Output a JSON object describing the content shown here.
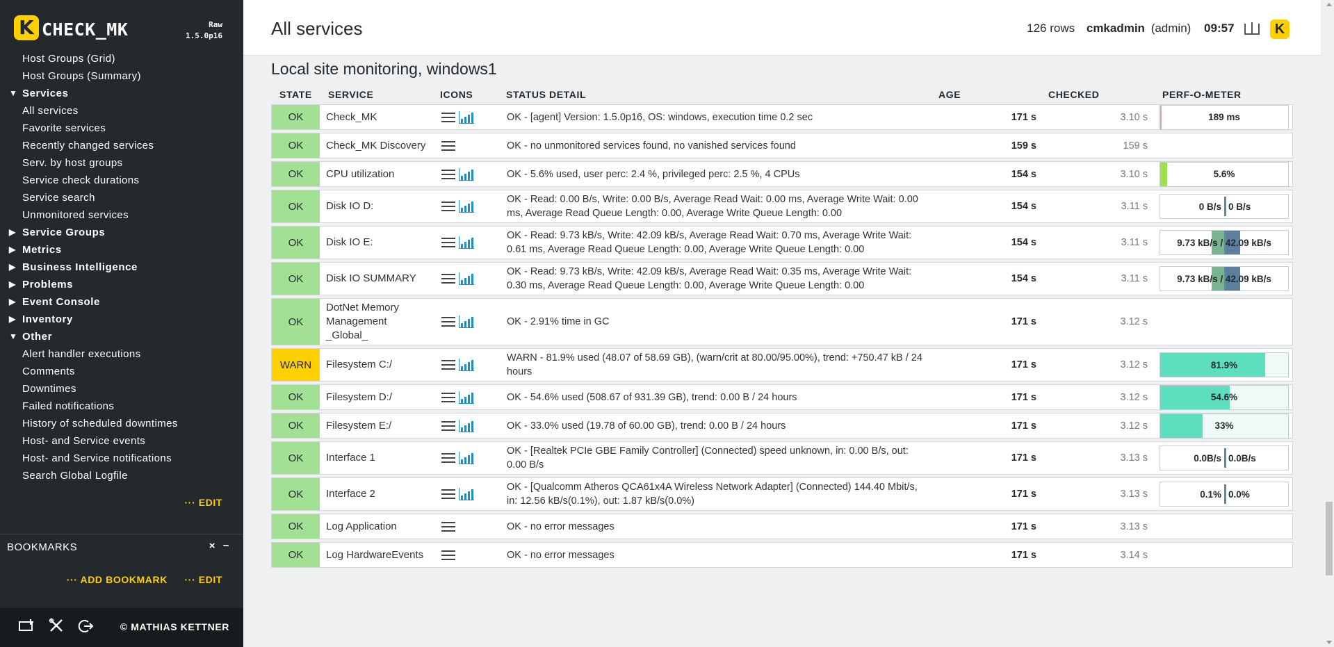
{
  "brand": {
    "logo_letter": "K",
    "name": "CHECK_MK",
    "edition": "Raw",
    "version": "1.5.0p16"
  },
  "sidebar": {
    "items": [
      {
        "type": "item",
        "label": "Host Groups (Grid)"
      },
      {
        "type": "item",
        "label": "Host Groups (Summary)"
      },
      {
        "type": "section",
        "label": "Services",
        "expanded": true
      },
      {
        "type": "item",
        "label": "All services"
      },
      {
        "type": "item",
        "label": "Favorite services"
      },
      {
        "type": "item",
        "label": "Recently changed services"
      },
      {
        "type": "item",
        "label": "Serv. by host groups"
      },
      {
        "type": "item",
        "label": "Service check durations"
      },
      {
        "type": "item",
        "label": "Service search"
      },
      {
        "type": "item",
        "label": "Unmonitored services"
      },
      {
        "type": "section",
        "label": "Service Groups",
        "expanded": false
      },
      {
        "type": "section",
        "label": "Metrics",
        "expanded": false
      },
      {
        "type": "section",
        "label": "Business Intelligence",
        "expanded": false
      },
      {
        "type": "section",
        "label": "Problems",
        "expanded": false
      },
      {
        "type": "section",
        "label": "Event Console",
        "expanded": false
      },
      {
        "type": "section",
        "label": "Inventory",
        "expanded": false
      },
      {
        "type": "section",
        "label": "Other",
        "expanded": true
      },
      {
        "type": "item",
        "label": "Alert handler executions"
      },
      {
        "type": "item",
        "label": "Comments"
      },
      {
        "type": "item",
        "label": "Downtimes"
      },
      {
        "type": "item",
        "label": "Failed notifications"
      },
      {
        "type": "item",
        "label": "History of scheduled downtimes"
      },
      {
        "type": "item",
        "label": "Host- and Service events"
      },
      {
        "type": "item",
        "label": "Host- and Service notifications"
      },
      {
        "type": "item",
        "label": "Search Global Logfile"
      }
    ],
    "views_edit": "··· EDIT",
    "bookmarks_title": "BOOKMARKS",
    "bookmarks_close": "×",
    "bookmarks_minimize": "−",
    "add_bookmark": "··· ADD BOOKMARK",
    "bookmarks_edit": "··· EDIT",
    "copyright": "© MATHIAS KETTNER"
  },
  "header": {
    "title": "All services",
    "rows": "126 rows",
    "user": "cmkadmin",
    "role": "(admin)",
    "time": "09:57"
  },
  "group_title": "Local site monitoring, windows1",
  "columns": [
    "STATE",
    "SERVICE",
    "ICONS",
    "STATUS DETAIL",
    "AGE",
    "CHECKED",
    "PERF-O-METER"
  ],
  "colors": {
    "ok": "#a2e093",
    "warn": "#ffd000",
    "brand": "#ffd000",
    "sidebar": "#23292d"
  },
  "services": [
    {
      "state": "OK",
      "service": "Check_MK",
      "graph": true,
      "detail": "OK - [agent] Version: 1.5.0p16, OS: windows, execution time 0.2 sec",
      "age": "171 s",
      "checked": "3.10 s",
      "h": 37,
      "perf": {
        "kind": "bar",
        "label": "189 ms",
        "fill": 0.01,
        "color": "#d4a5b8"
      }
    },
    {
      "state": "OK",
      "service": "Check_MK Discovery",
      "graph": false,
      "detail": "OK - no unmonitored services found, no vanished services found",
      "age": "159 s",
      "checked": "159 s",
      "h": 37,
      "perf": null
    },
    {
      "state": "OK",
      "service": "CPU utilization",
      "graph": true,
      "detail": "OK - 5.6% used, user perc: 2.4 %, privileged perc: 2.5 %, 4 CPUs",
      "age": "154 s",
      "checked": "3.10 s",
      "h": 37,
      "perf": {
        "kind": "bar",
        "label": "5.6%",
        "fill": 0.056,
        "color": "#a0e050"
      }
    },
    {
      "state": "OK",
      "service": "Disk IO D:",
      "graph": true,
      "detail": "OK - Read: 0.00 B/s, Write: 0.00 B/s, Average Read Wait: 0.00 ms, Average Write Wait: 0.00 ms, Average Read Queue Length: 0.00, Average Write Queue Length: 0.00",
      "age": "154 s",
      "checked": "3.11 s",
      "h": 48,
      "perf": {
        "kind": "split",
        "left": "0 B/s",
        "right": "0 B/s",
        "lfill": 0,
        "rfill": 0
      }
    },
    {
      "state": "OK",
      "service": "Disk IO E:",
      "graph": true,
      "detail": "OK - Read: 9.73 kB/s, Write: 42.09 kB/s, Average Read Wait: 0.70 ms, Average Write Wait: 0.61 ms, Average Read Queue Length: 0.00, Average Write Queue Length: 0.00",
      "age": "154 s",
      "checked": "3.11 s",
      "h": 48,
      "perf": {
        "kind": "split",
        "label": "9.73 kB/s / 42.09 kB/s",
        "lfill": 0.2,
        "rfill": 0.25
      }
    },
    {
      "state": "OK",
      "service": "Disk IO SUMMARY",
      "graph": true,
      "detail": "OK - Read: 9.73 kB/s, Write: 42.09 kB/s, Average Read Wait: 0.35 ms, Average Write Wait: 0.30 ms, Average Read Queue Length: 0.00, Average Write Queue Length: 0.00",
      "age": "154 s",
      "checked": "3.11 s",
      "h": 48,
      "perf": {
        "kind": "split",
        "label": "9.73 kB/s / 42.09 kB/s",
        "lfill": 0.2,
        "rfill": 0.25
      }
    },
    {
      "state": "OK",
      "service": "DotNet Memory Management _Global_",
      "graph": true,
      "detail": "OK - 2.91% time in GC",
      "age": "171 s",
      "checked": "3.12 s",
      "h": 68,
      "perf": null
    },
    {
      "state": "WARN",
      "service": "Filesystem C:/",
      "graph": true,
      "detail": "WARN - 81.9% used (48.07 of 58.69 GB), (warn/crit at 80.00/95.00%), trend: +750.47 kB / 24 hours",
      "age": "171 s",
      "checked": "3.12 s",
      "h": 48,
      "perf": {
        "kind": "bar",
        "label": "81.9%",
        "fill": 0.819,
        "color": "#5ddfbf"
      }
    },
    {
      "state": "OK",
      "service": "Filesystem D:/",
      "graph": true,
      "detail": "OK - 54.6% used (508.67 of 931.39 GB), trend: 0.00 B / 24 hours",
      "age": "171 s",
      "checked": "3.12 s",
      "h": 37,
      "perf": {
        "kind": "bar",
        "label": "54.6%",
        "fill": 0.546,
        "color": "#5ddfbf"
      }
    },
    {
      "state": "OK",
      "service": "Filesystem E:/",
      "graph": true,
      "detail": "OK - 33.0% used (19.78 of 60.00 GB), trend: 0.00 B / 24 hours",
      "age": "171 s",
      "checked": "3.12 s",
      "h": 37,
      "perf": {
        "kind": "bar",
        "label": "33%",
        "fill": 0.33,
        "color": "#5ddfbf"
      }
    },
    {
      "state": "OK",
      "service": "Interface 1",
      "graph": true,
      "detail": "OK - [Realtek PCIe GBE Family Controller] (Connected) speed unknown, in: 0.00 B/s, out: 0.00 B/s",
      "age": "171 s",
      "checked": "3.13 s",
      "h": 48,
      "perf": {
        "kind": "split",
        "left": "0.0B/s",
        "right": "0.0B/s",
        "lfill": 0,
        "rfill": 0
      }
    },
    {
      "state": "OK",
      "service": "Interface 2",
      "graph": true,
      "detail": "OK - [Qualcomm Atheros QCA61x4A Wireless Network Adapter] (Connected) 144.40 Mbit/s, in: 12.56 kB/s(0.1%), out: 1.87 kB/s(0.0%)",
      "age": "171 s",
      "checked": "3.13 s",
      "h": 48,
      "perf": {
        "kind": "split",
        "left": "0.1%",
        "right": "0.0%",
        "lfill": 0,
        "rfill": 0
      }
    },
    {
      "state": "OK",
      "service": "Log Application",
      "graph": false,
      "detail": "OK - no error messages",
      "age": "171 s",
      "checked": "3.13 s",
      "h": 37,
      "perf": null
    },
    {
      "state": "OK",
      "service": "Log HardwareEvents",
      "graph": false,
      "detail": "OK - no error messages",
      "age": "171 s",
      "checked": "3.14 s",
      "h": 37,
      "perf": null
    }
  ]
}
